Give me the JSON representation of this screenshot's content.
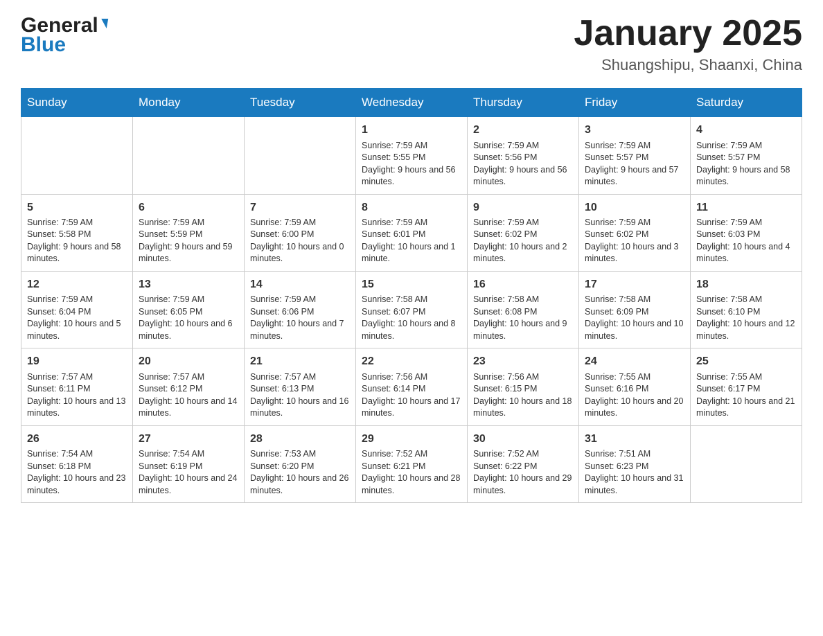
{
  "header": {
    "month_title": "January 2025",
    "location": "Shuangshipu, Shaanxi, China",
    "logo_general": "General",
    "logo_blue": "Blue"
  },
  "days_of_week": [
    "Sunday",
    "Monday",
    "Tuesday",
    "Wednesday",
    "Thursday",
    "Friday",
    "Saturday"
  ],
  "weeks": [
    [
      null,
      null,
      null,
      {
        "day": "1",
        "sunrise": "Sunrise: 7:59 AM",
        "sunset": "Sunset: 5:55 PM",
        "daylight": "Daylight: 9 hours and 56 minutes."
      },
      {
        "day": "2",
        "sunrise": "Sunrise: 7:59 AM",
        "sunset": "Sunset: 5:56 PM",
        "daylight": "Daylight: 9 hours and 56 minutes."
      },
      {
        "day": "3",
        "sunrise": "Sunrise: 7:59 AM",
        "sunset": "Sunset: 5:57 PM",
        "daylight": "Daylight: 9 hours and 57 minutes."
      },
      {
        "day": "4",
        "sunrise": "Sunrise: 7:59 AM",
        "sunset": "Sunset: 5:57 PM",
        "daylight": "Daylight: 9 hours and 58 minutes."
      }
    ],
    [
      {
        "day": "5",
        "sunrise": "Sunrise: 7:59 AM",
        "sunset": "Sunset: 5:58 PM",
        "daylight": "Daylight: 9 hours and 58 minutes."
      },
      {
        "day": "6",
        "sunrise": "Sunrise: 7:59 AM",
        "sunset": "Sunset: 5:59 PM",
        "daylight": "Daylight: 9 hours and 59 minutes."
      },
      {
        "day": "7",
        "sunrise": "Sunrise: 7:59 AM",
        "sunset": "Sunset: 6:00 PM",
        "daylight": "Daylight: 10 hours and 0 minutes."
      },
      {
        "day": "8",
        "sunrise": "Sunrise: 7:59 AM",
        "sunset": "Sunset: 6:01 PM",
        "daylight": "Daylight: 10 hours and 1 minute."
      },
      {
        "day": "9",
        "sunrise": "Sunrise: 7:59 AM",
        "sunset": "Sunset: 6:02 PM",
        "daylight": "Daylight: 10 hours and 2 minutes."
      },
      {
        "day": "10",
        "sunrise": "Sunrise: 7:59 AM",
        "sunset": "Sunset: 6:02 PM",
        "daylight": "Daylight: 10 hours and 3 minutes."
      },
      {
        "day": "11",
        "sunrise": "Sunrise: 7:59 AM",
        "sunset": "Sunset: 6:03 PM",
        "daylight": "Daylight: 10 hours and 4 minutes."
      }
    ],
    [
      {
        "day": "12",
        "sunrise": "Sunrise: 7:59 AM",
        "sunset": "Sunset: 6:04 PM",
        "daylight": "Daylight: 10 hours and 5 minutes."
      },
      {
        "day": "13",
        "sunrise": "Sunrise: 7:59 AM",
        "sunset": "Sunset: 6:05 PM",
        "daylight": "Daylight: 10 hours and 6 minutes."
      },
      {
        "day": "14",
        "sunrise": "Sunrise: 7:59 AM",
        "sunset": "Sunset: 6:06 PM",
        "daylight": "Daylight: 10 hours and 7 minutes."
      },
      {
        "day": "15",
        "sunrise": "Sunrise: 7:58 AM",
        "sunset": "Sunset: 6:07 PM",
        "daylight": "Daylight: 10 hours and 8 minutes."
      },
      {
        "day": "16",
        "sunrise": "Sunrise: 7:58 AM",
        "sunset": "Sunset: 6:08 PM",
        "daylight": "Daylight: 10 hours and 9 minutes."
      },
      {
        "day": "17",
        "sunrise": "Sunrise: 7:58 AM",
        "sunset": "Sunset: 6:09 PM",
        "daylight": "Daylight: 10 hours and 10 minutes."
      },
      {
        "day": "18",
        "sunrise": "Sunrise: 7:58 AM",
        "sunset": "Sunset: 6:10 PM",
        "daylight": "Daylight: 10 hours and 12 minutes."
      }
    ],
    [
      {
        "day": "19",
        "sunrise": "Sunrise: 7:57 AM",
        "sunset": "Sunset: 6:11 PM",
        "daylight": "Daylight: 10 hours and 13 minutes."
      },
      {
        "day": "20",
        "sunrise": "Sunrise: 7:57 AM",
        "sunset": "Sunset: 6:12 PM",
        "daylight": "Daylight: 10 hours and 14 minutes."
      },
      {
        "day": "21",
        "sunrise": "Sunrise: 7:57 AM",
        "sunset": "Sunset: 6:13 PM",
        "daylight": "Daylight: 10 hours and 16 minutes."
      },
      {
        "day": "22",
        "sunrise": "Sunrise: 7:56 AM",
        "sunset": "Sunset: 6:14 PM",
        "daylight": "Daylight: 10 hours and 17 minutes."
      },
      {
        "day": "23",
        "sunrise": "Sunrise: 7:56 AM",
        "sunset": "Sunset: 6:15 PM",
        "daylight": "Daylight: 10 hours and 18 minutes."
      },
      {
        "day": "24",
        "sunrise": "Sunrise: 7:55 AM",
        "sunset": "Sunset: 6:16 PM",
        "daylight": "Daylight: 10 hours and 20 minutes."
      },
      {
        "day": "25",
        "sunrise": "Sunrise: 7:55 AM",
        "sunset": "Sunset: 6:17 PM",
        "daylight": "Daylight: 10 hours and 21 minutes."
      }
    ],
    [
      {
        "day": "26",
        "sunrise": "Sunrise: 7:54 AM",
        "sunset": "Sunset: 6:18 PM",
        "daylight": "Daylight: 10 hours and 23 minutes."
      },
      {
        "day": "27",
        "sunrise": "Sunrise: 7:54 AM",
        "sunset": "Sunset: 6:19 PM",
        "daylight": "Daylight: 10 hours and 24 minutes."
      },
      {
        "day": "28",
        "sunrise": "Sunrise: 7:53 AM",
        "sunset": "Sunset: 6:20 PM",
        "daylight": "Daylight: 10 hours and 26 minutes."
      },
      {
        "day": "29",
        "sunrise": "Sunrise: 7:52 AM",
        "sunset": "Sunset: 6:21 PM",
        "daylight": "Daylight: 10 hours and 28 minutes."
      },
      {
        "day": "30",
        "sunrise": "Sunrise: 7:52 AM",
        "sunset": "Sunset: 6:22 PM",
        "daylight": "Daylight: 10 hours and 29 minutes."
      },
      {
        "day": "31",
        "sunrise": "Sunrise: 7:51 AM",
        "sunset": "Sunset: 6:23 PM",
        "daylight": "Daylight: 10 hours and 31 minutes."
      },
      null
    ]
  ]
}
